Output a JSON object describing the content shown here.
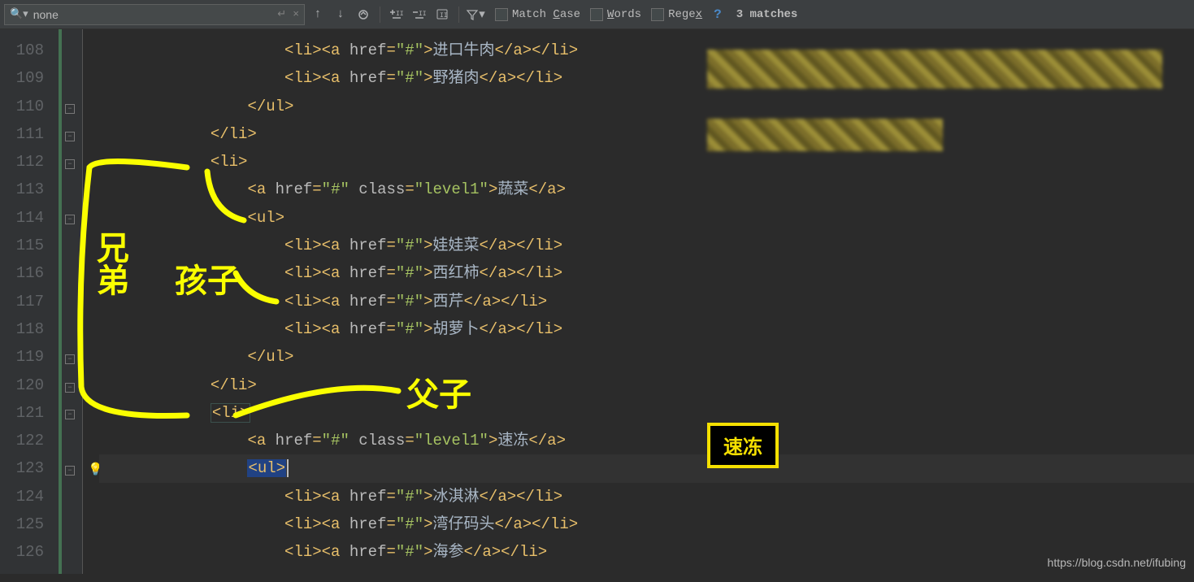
{
  "search": {
    "value": "none",
    "history_icon": "↵",
    "close_icon": "×"
  },
  "toolbar": {
    "prev": "↑",
    "next": "↓",
    "checkboxes": {
      "match_case_pre": "Match ",
      "match_case_u": "C",
      "match_case_post": "ase",
      "words_u": "W",
      "words_post": "ords",
      "regex_pre": "Rege",
      "regex_u": "x"
    },
    "help": "?",
    "matches": "3 matches"
  },
  "lines": {
    "start": 108,
    "items": [
      {
        "n": 108,
        "indent": 20,
        "type": "li-a",
        "txt": "进口牛肉"
      },
      {
        "n": 109,
        "indent": 20,
        "type": "li-a",
        "txt": "野猪肉"
      },
      {
        "n": 110,
        "indent": 16,
        "type": "close",
        "tag": "ul"
      },
      {
        "n": 111,
        "indent": 12,
        "type": "close",
        "tag": "li"
      },
      {
        "n": 112,
        "indent": 12,
        "type": "open",
        "tag": "li"
      },
      {
        "n": 113,
        "indent": 16,
        "type": "a-level",
        "txt": "蔬菜"
      },
      {
        "n": 114,
        "indent": 16,
        "type": "open",
        "tag": "ul"
      },
      {
        "n": 115,
        "indent": 20,
        "type": "li-a",
        "txt": "娃娃菜"
      },
      {
        "n": 116,
        "indent": 20,
        "type": "li-a",
        "txt": "西红柿"
      },
      {
        "n": 117,
        "indent": 20,
        "type": "li-a",
        "txt": "西芹"
      },
      {
        "n": 118,
        "indent": 20,
        "type": "li-a",
        "txt": "胡萝卜"
      },
      {
        "n": 119,
        "indent": 16,
        "type": "close",
        "tag": "ul"
      },
      {
        "n": 120,
        "indent": 12,
        "type": "close",
        "tag": "li"
      },
      {
        "n": 121,
        "indent": 12,
        "type": "open-hl",
        "tag": "li"
      },
      {
        "n": 122,
        "indent": 16,
        "type": "a-level",
        "txt": "速冻"
      },
      {
        "n": 123,
        "indent": 16,
        "type": "open-sel",
        "tag": "ul",
        "current": true
      },
      {
        "n": 124,
        "indent": 20,
        "type": "li-a",
        "txt": "冰淇淋"
      },
      {
        "n": 125,
        "indent": 20,
        "type": "li-a",
        "txt": "湾仔码头"
      },
      {
        "n": 126,
        "indent": 20,
        "type": "li-a",
        "txt": "海参"
      }
    ]
  },
  "tooltip": "速冻",
  "handwriting": {
    "sibling": "兄弟",
    "child": "孩子",
    "parent": "父子"
  },
  "watermark": "https://blog.csdn.net/ifubing"
}
